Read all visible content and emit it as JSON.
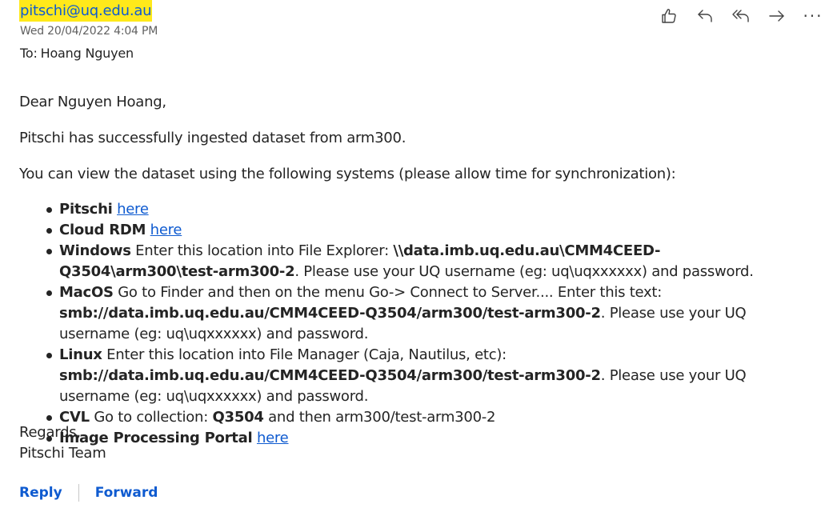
{
  "header": {
    "sender_email": "pitschi@uq.edu.au",
    "date": "Wed 20/04/2022 4:04 PM",
    "to_label": "To:",
    "to_name": "Hoang Nguyen"
  },
  "actions": {
    "more_label": "···"
  },
  "body": {
    "greeting": "Dear Nguyen Hoang,",
    "ingested": "Pitschi has successfully ingested dataset from arm300.",
    "view_intro": "You can view the dataset using the following systems (please allow time for synchronization):",
    "items": [
      {
        "name": "Pitschi",
        "link": "here"
      },
      {
        "name": "Cloud RDM",
        "link": "here"
      },
      {
        "name": "Windows",
        "text": "Enter this location into File Explorer:",
        "path": "\\\\data.imb.uq.edu.au\\CMM4CEED-Q3504\\arm300\\test-arm300-2",
        "tail": ". Please use your UQ username (eg: uq\\uqxxxxxx) and password."
      },
      {
        "name": "MacOS",
        "text": "Go to Finder and then on the menu Go-> Connect to Server.... Enter this text:",
        "path": "smb://data.imb.uq.edu.au/CMM4CEED-Q3504/arm300/test-arm300-2",
        "tail": ". Please use your UQ username (eg: uq\\uqxxxxxx) and password."
      },
      {
        "name": "Linux",
        "text": "Enter this location into File Manager (Caja, Nautilus, etc):",
        "path": "smb://data.imb.uq.edu.au/CMM4CEED-Q3504/arm300/test-arm300-2",
        "tail": ". Please use your UQ username (eg: uq\\uqxxxxxx) and password."
      },
      {
        "name": "CVL",
        "text": "Go to collection:",
        "path": "Q3504",
        "tail": "and then arm300/test-arm300-2"
      },
      {
        "name": "Image Processing Portal",
        "link": "here"
      }
    ],
    "regards": "Regards,",
    "signature": "Pitschi Team"
  },
  "footer": {
    "reply": "Reply",
    "forward": "Forward"
  },
  "icons": [
    "like-icon",
    "reply-icon",
    "reply-all-icon",
    "forward-icon",
    "more-icon"
  ],
  "colors": {
    "link": "#0f5bd0",
    "highlight": "#ffe91a",
    "text": "#242424"
  }
}
